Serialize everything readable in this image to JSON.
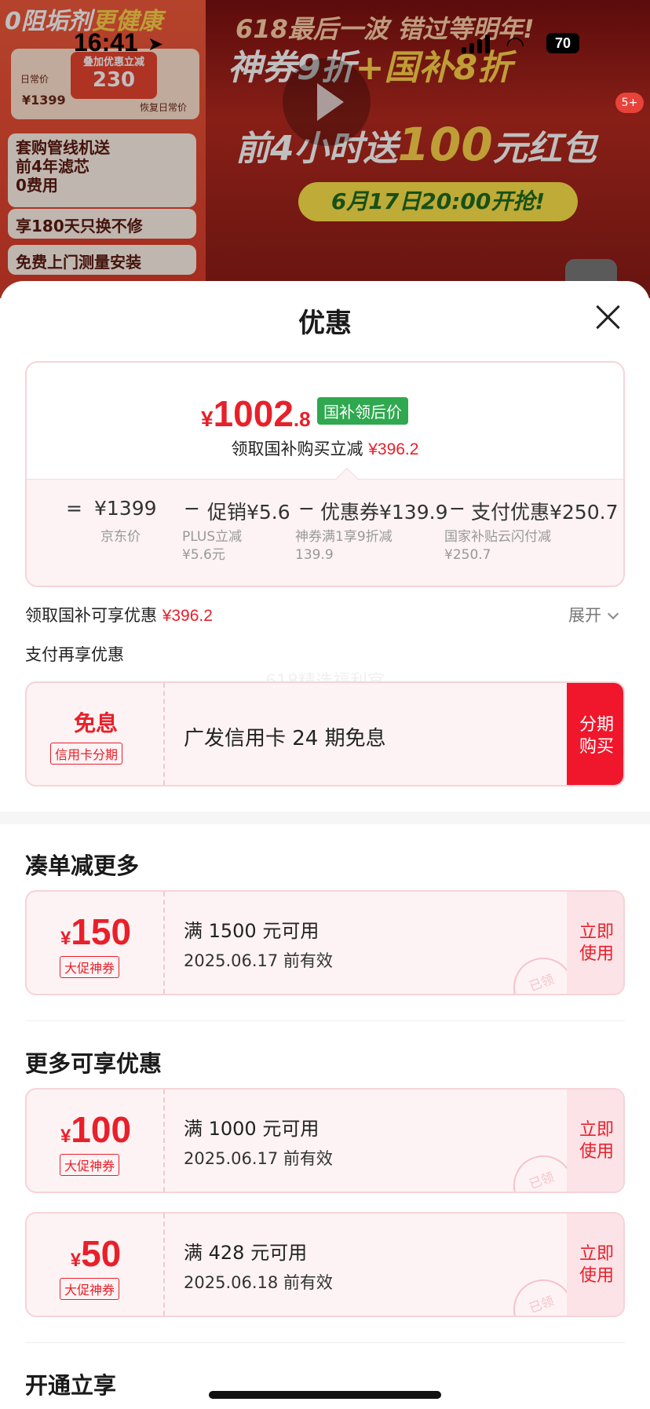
{
  "status_bar": {
    "time": "16:41",
    "battery": "70"
  },
  "banner": {
    "left_title_a": "0阻垢剂",
    "left_title_b": "更健康",
    "price_tag_small": "叠加优惠立减",
    "price_tag_value": "230",
    "daily_label": "日常价",
    "daily_value": "¥1399",
    "restore_label": "恢复日常价",
    "card1": "套购管线机送\n前4年滤芯\n0费用",
    "card2": "享180天只换不修",
    "card3": "免费上门测量安装",
    "right_title": "618最后一波 错过等明年!",
    "right_sub_a": "神券9折",
    "right_sub_b": "+国补8折",
    "big_a": "前4小时送",
    "big_b": "100",
    "big_c": "元红包",
    "date_pill": "6月17日20:00开抢!",
    "badge": "5+"
  },
  "sheet": {
    "title": "优惠",
    "final_price": {
      "currency": "¥",
      "integer": "1002",
      "decimal": ".8"
    },
    "gov_tag": "国补领后价",
    "reduce_text": "领取国补购买立减",
    "reduce_amount": "¥396.2",
    "calc": {
      "eq": "=",
      "jd_price": "¥1399",
      "minus1": "−",
      "promo": "促销¥5.6",
      "minus2": "−",
      "coupon": "优惠券¥139.9",
      "minus3": "−",
      "pay": "支付优惠¥250.7",
      "jd_label": "京东价",
      "promo_sub1": "PLUS立减",
      "promo_sub2": "¥5.6元",
      "coupon_sub1": "神券满1享9折减",
      "coupon_sub2": "139.9",
      "pay_sub1": "国家补贴云闪付减",
      "pay_sub2": "¥250.7"
    },
    "gov_line_label": "领取国补可享优惠",
    "gov_line_amount": "¥396.2",
    "expand": "展开",
    "pay_line": "支付再享优惠",
    "watermark": "618精选福利官",
    "credit": {
      "big": "免息",
      "tag": "信用卡分期",
      "text": "广发信用卡 24 期免息",
      "btn_line1": "分期",
      "btn_line2": "购买"
    },
    "section1": "凑单减更多",
    "section2": "更多可享优惠",
    "section3": "开通立享",
    "coupons": [
      {
        "currency": "¥",
        "amount": "150",
        "tag": "大促神券",
        "cond": "满 1500 元可用",
        "date": "2025.06.17 前有效",
        "btn1": "立即",
        "btn2": "使用",
        "stamp": "已领"
      },
      {
        "currency": "¥",
        "amount": "100",
        "tag": "大促神券",
        "cond": "满 1000 元可用",
        "date": "2025.06.17 前有效",
        "btn1": "立即",
        "btn2": "使用",
        "stamp": "已领"
      },
      {
        "currency": "¥",
        "amount": "50",
        "tag": "大促神券",
        "cond": "满 428 元可用",
        "date": "2025.06.18 前有效",
        "btn1": "立即",
        "btn2": "使用",
        "stamp": "已领"
      }
    ]
  }
}
